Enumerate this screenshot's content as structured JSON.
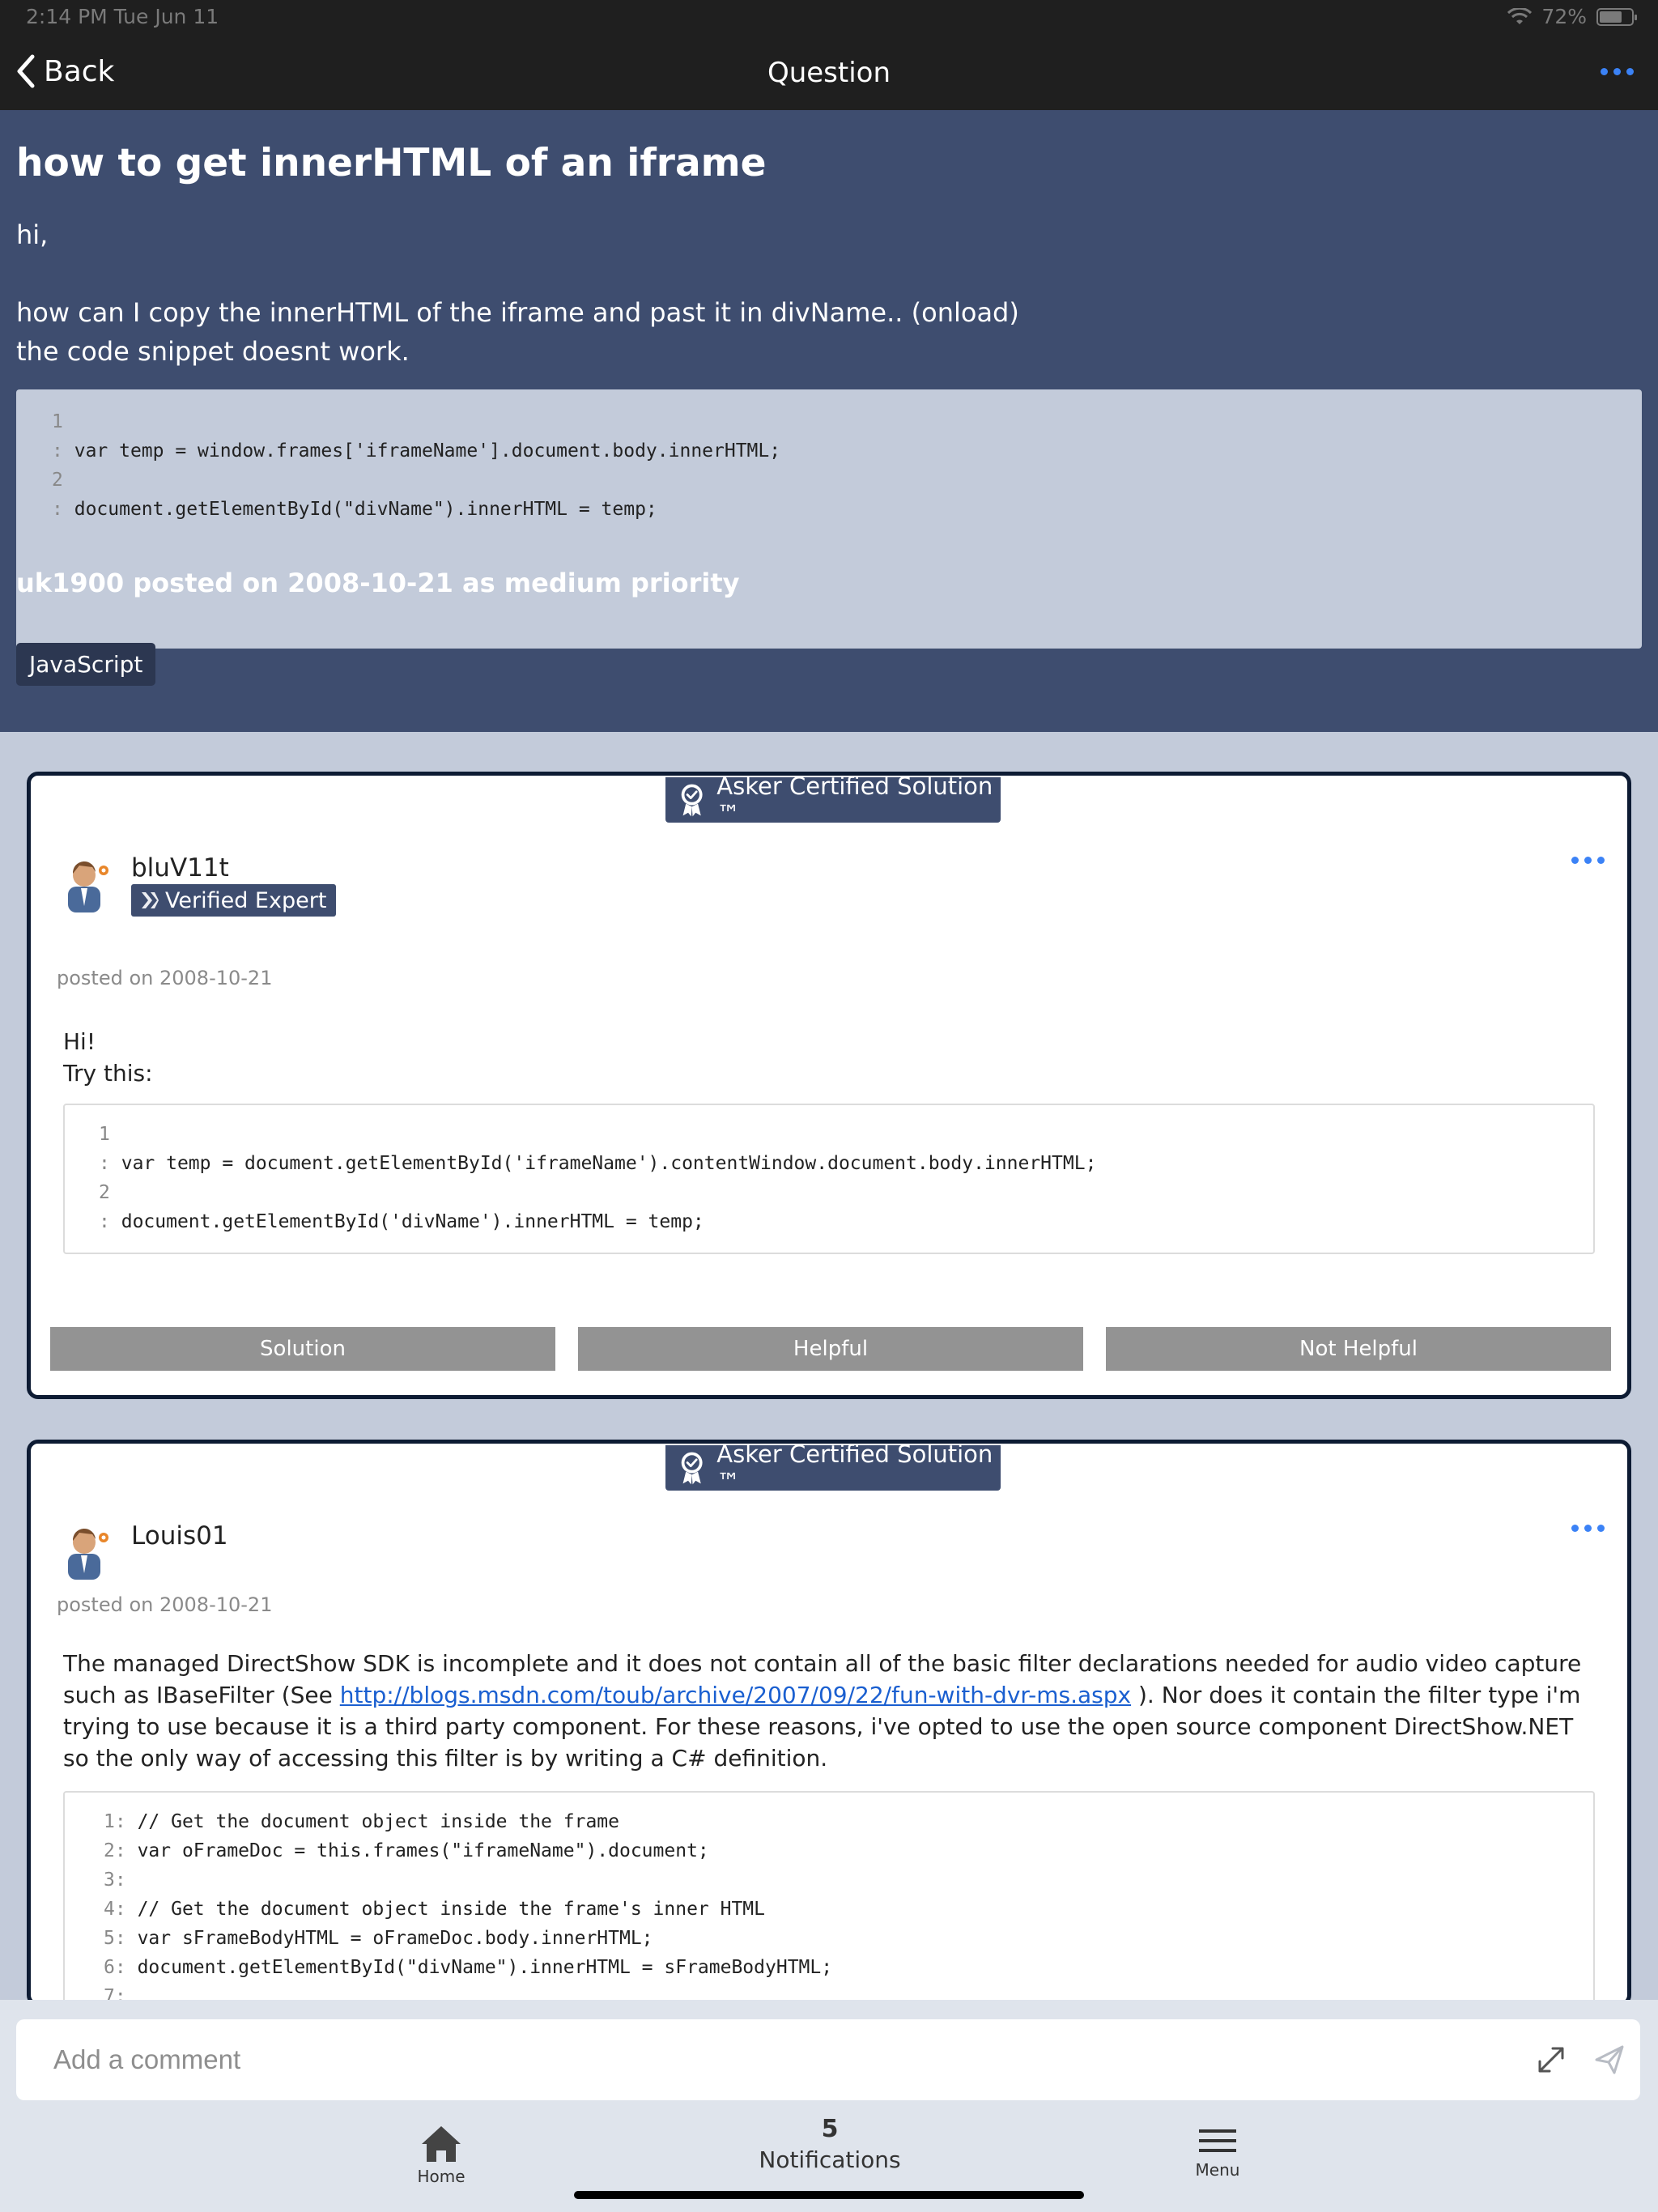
{
  "status_bar": {
    "time": "2:14 PM   Tue Jun 11",
    "battery": "72%"
  },
  "nav": {
    "back_label": "Back",
    "title": "Question"
  },
  "question": {
    "title": "how to get innerHTML of an iframe",
    "body": [
      "hi,",
      "how can I copy the innerHTML of the iframe and past it in divName.. (onload)",
      "the code snippet doesnt work."
    ],
    "code": [
      {
        "ln": "1",
        "text": ""
      },
      {
        "ln": ":",
        "text": "var temp = window.frames['iframeName'].document.body.innerHTML;"
      },
      {
        "ln": "2",
        "text": ""
      },
      {
        "ln": ":",
        "text": "document.getElementById(\"divName\").innerHTML = temp;"
      }
    ],
    "meta": "uk1900 posted on 2008-10-21 as medium priority",
    "tag": "JavaScript"
  },
  "answers": [
    {
      "badge": "Asker Certified Solution ™",
      "user": "bluV11t",
      "expert_label": "Verified Expert",
      "posted": "posted on 2008-10-21",
      "text": [
        "Hi!",
        "Try this:"
      ],
      "code": [
        {
          "ln": "1",
          "text": ""
        },
        {
          "ln": ":",
          "text": "var temp = document.getElementById('iframeName').contentWindow.document.body.innerHTML;"
        },
        {
          "ln": "2",
          "text": ""
        },
        {
          "ln": ":",
          "text": "document.getElementById('divName').innerHTML = temp;"
        }
      ],
      "actions": {
        "solution": "Solution",
        "helpful": "Helpful",
        "not_helpful": "Not Helpful"
      }
    },
    {
      "badge": "Asker Certified Solution ™",
      "user": "Louis01",
      "posted": "posted on 2008-10-21",
      "text_before_link": "The managed DirectShow SDK is incomplete and it does not contain all of the basic filter declarations needed for audio video capture such as IBaseFilter (See ",
      "link": "http://blogs.msdn.com/toub/archive/2007/09/22/fun-with-dvr-ms.aspx",
      "text_after_link": " ). Nor does it contain the filter type i'm trying to use because it is a third party component. For these reasons, i've opted to use the open source component DirectShow.NET so the only way of accessing this filter is by writing a C# definition.",
      "code": [
        {
          "ln": "1:",
          "text": "// Get the document object inside the frame"
        },
        {
          "ln": "2:",
          "text": "var oFrameDoc = this.frames(\"iframeName\").document;"
        },
        {
          "ln": "3:",
          "text": ""
        },
        {
          "ln": "4:",
          "text": "// Get the document object inside the frame's inner HTML"
        },
        {
          "ln": "5:",
          "text": "var sFrameBodyHTML = oFrameDoc.body.innerHTML;"
        },
        {
          "ln": "6:",
          "text": "document.getElementById(\"divName\").innerHTML = sFrameBodyHTML;"
        },
        {
          "ln": "7:",
          "text": ""
        }
      ]
    }
  ],
  "comment": {
    "placeholder": "Add a comment"
  },
  "tabs": {
    "home": "Home",
    "notifications_count": "5",
    "notifications": "Notifications",
    "menu": "Menu"
  },
  "colors": {
    "header_bg": "#1f1f1f",
    "question_bg": "#3e4d6f",
    "page_bg": "#c3cbda",
    "accent_blue": "#3b82f6",
    "card_border": "#0d1b33",
    "action_button": "#939393"
  }
}
